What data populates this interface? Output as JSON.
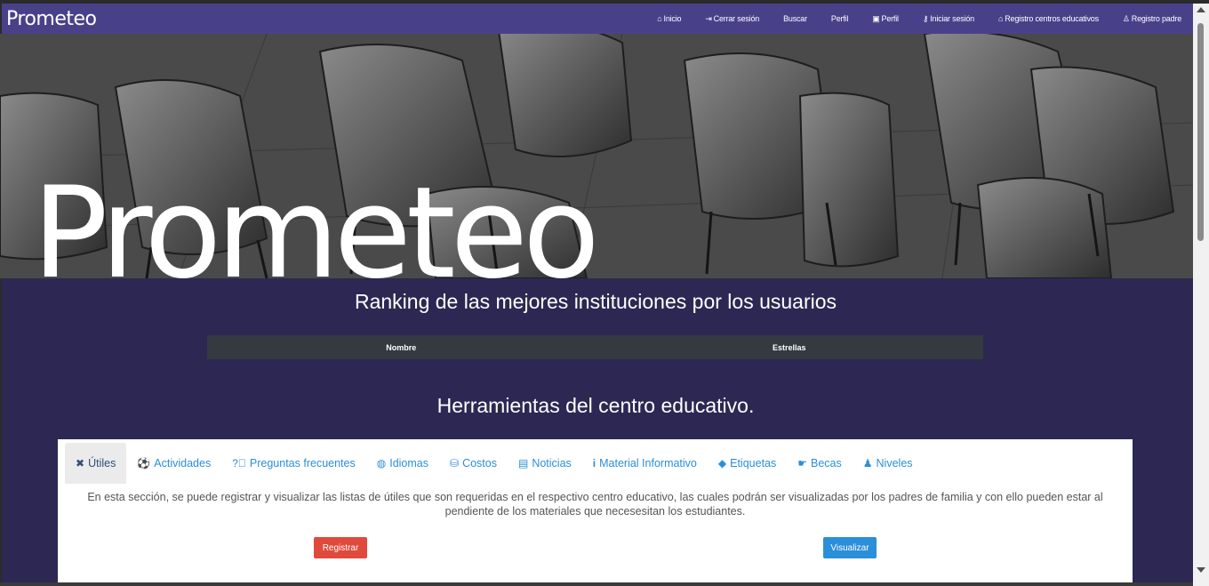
{
  "navbar": {
    "brand": "Prometeo",
    "links": [
      {
        "label": "Inicio",
        "icon": "home-icon"
      },
      {
        "label": "Cerrar sesión",
        "icon": "sign-out-icon"
      },
      {
        "label": "Buscar",
        "icon": ""
      },
      {
        "label": "Perfil",
        "icon": ""
      },
      {
        "label": "Perfil",
        "icon": "id-card-icon"
      },
      {
        "label": "Iniciar sesión",
        "icon": "key-icon"
      },
      {
        "label": "Registro centros educativos",
        "icon": "school-icon"
      },
      {
        "label": "Registro padre",
        "icon": "user-icon"
      }
    ]
  },
  "hero": {
    "title": "Prometeo"
  },
  "ranking": {
    "heading": "Ranking de las mejores instituciones por los usuarios",
    "columns": [
      "Nombre",
      "Estrellas"
    ]
  },
  "tools": {
    "heading": "Herramientas del centro educativo.",
    "tabs": [
      {
        "label": "Útiles",
        "icon": "tools-icon",
        "active": true
      },
      {
        "label": "Actividades",
        "icon": "soccer-ball-icon"
      },
      {
        "label": "Preguntas frecuentes",
        "icon": "question-circle-icon"
      },
      {
        "label": "Idiomas",
        "icon": "globe-icon"
      },
      {
        "label": "Costos",
        "icon": "coins-icon"
      },
      {
        "label": "Noticias",
        "icon": "newspaper-icon"
      },
      {
        "label": "Material Informativo",
        "icon": "info-icon"
      },
      {
        "label": "Etiquetas",
        "icon": "tags-icon"
      },
      {
        "label": "Becas",
        "icon": "hand-holding-money-icon"
      },
      {
        "label": "Niveles",
        "icon": "child-icon"
      }
    ],
    "description": "En esta sección, se puede registrar y visualizar las listas de útiles que son requeridas en el respectivo centro educativo, las cuales podrán ser visualizadas por los padres de familia y con ello pueden estar al pendiente de los materiales que necesesitan los estudiantes.",
    "register_label": "Registrar",
    "view_label": "Visualizar"
  },
  "colors": {
    "navbar_bg": "#48418a",
    "page_bg": "#2c2853",
    "link_blue": "#2a8fd8",
    "register_red": "#e04a3c"
  }
}
